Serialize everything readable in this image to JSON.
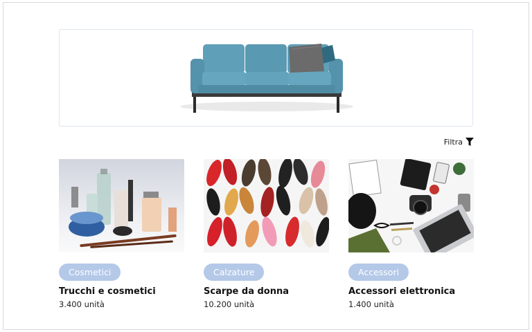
{
  "banner": {
    "image": "sofa-photo"
  },
  "filter": {
    "label": "Filtra",
    "icon": "funnel-icon"
  },
  "cards": [
    {
      "category": "Cosmetici",
      "title": "Trucchi e cosmetici",
      "quantity": "3.400 unità",
      "image": "cosmetics-photo"
    },
    {
      "category": "Calzature",
      "title": "Scarpe da donna",
      "quantity": "10.200 unità",
      "image": "shoes-photo"
    },
    {
      "category": "Accessori",
      "title": "Accessori elettronica",
      "quantity": "1.400 unità",
      "image": "electronics-photo"
    }
  ],
  "colors": {
    "badge": "#b4c8e8",
    "sofa": "#5b9bb5",
    "cushion": "#6a6a6a"
  }
}
